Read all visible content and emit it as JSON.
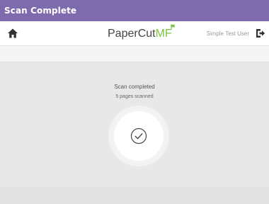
{
  "window": {
    "title": "Scan Complete"
  },
  "topbar": {
    "home_icon": "home-icon",
    "logo": {
      "papercut": "PaperCut",
      "mf": "MF"
    },
    "user_name": "Simple Test User",
    "logout_icon": "logout-icon"
  },
  "scan": {
    "status": "Scan completed",
    "pages_scanned": "5 pages scanned",
    "status_icon": "checkmark-circle-icon"
  },
  "colors": {
    "title_bar": "#7e6bad",
    "brand_green": "#7dc243",
    "background": "#e8e8e8"
  }
}
